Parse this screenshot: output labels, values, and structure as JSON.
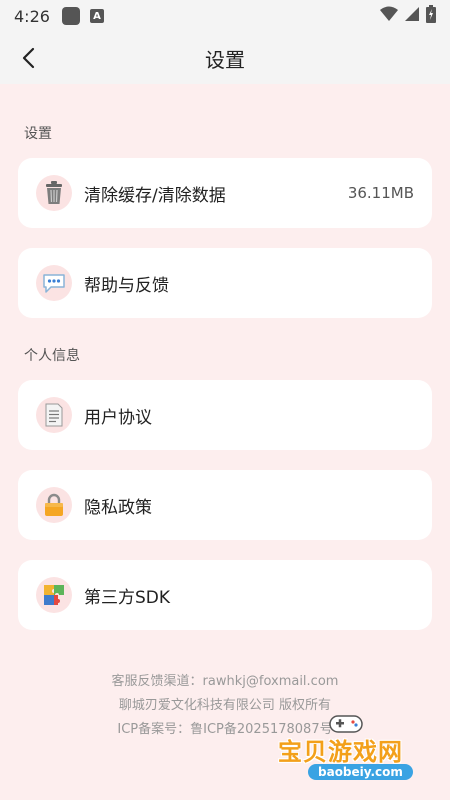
{
  "status": {
    "time": "4:26",
    "a_glyph": "A"
  },
  "header": {
    "title": "设置"
  },
  "sections": {
    "settings": "设置",
    "personal": "个人信息"
  },
  "items": {
    "clear_cache": {
      "label": "清除缓存/清除数据",
      "value": "36.11MB",
      "icon": "trash-icon"
    },
    "help": {
      "label": "帮助与反馈",
      "icon": "speech-bubble-icon"
    },
    "agreement": {
      "label": "用户协议",
      "icon": "document-icon"
    },
    "privacy": {
      "label": "隐私政策",
      "icon": "lock-icon"
    },
    "sdk": {
      "label": "第三方SDK",
      "icon": "puzzle-icon"
    }
  },
  "footer": {
    "contact": "客服反馈渠道：rawhkj@foxmail.com",
    "company": "聊城刃爱文化科技有限公司 版权所有",
    "icp": "ICP备案号：鲁ICP备2025178087号"
  },
  "watermark": {
    "text": "宝贝游戏网",
    "url": "baobeiy.com"
  },
  "colors": {
    "background": "#fdeeee",
    "card": "#ffffff",
    "icon_bg": "#fbe3e3"
  }
}
